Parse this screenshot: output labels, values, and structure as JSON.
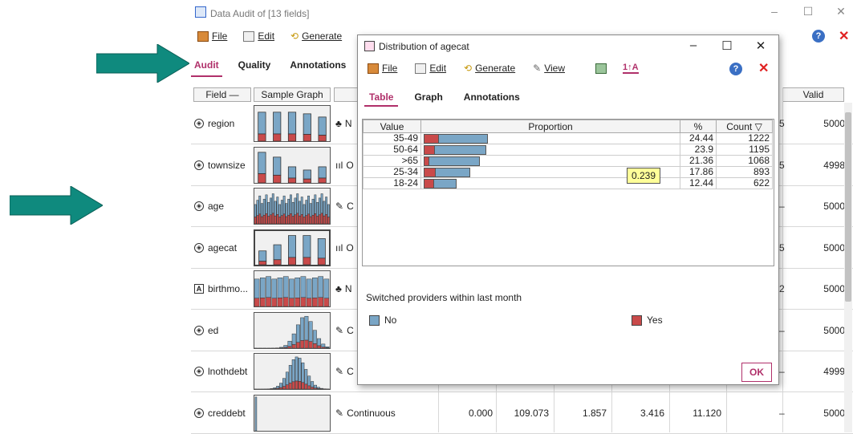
{
  "background_window": {
    "title": "Data Audit of [13 fields]",
    "menu": {
      "file": "File",
      "edit": "Edit",
      "generate": "Generate"
    },
    "tabs": [
      {
        "label": "Audit",
        "active": true
      },
      {
        "label": "Quality",
        "active": false
      },
      {
        "label": "Annotations",
        "active": false
      }
    ],
    "columns": {
      "field": "Field",
      "sample_graph": "Sample Graph",
      "valid": "Valid"
    },
    "rows": [
      {
        "field": "region",
        "icon": "nominal-icon",
        "measure_glyph": "♣",
        "measure": "N",
        "peek": "5",
        "valid": "5000"
      },
      {
        "field": "townsize",
        "icon": "ordinal-icon",
        "measure_glyph": "ııl",
        "measure": "O",
        "peek": "5",
        "valid": "4998"
      },
      {
        "field": "age",
        "icon": "continuous-icon",
        "measure_glyph": "✎",
        "measure": "C",
        "peek": "–",
        "valid": "5000"
      },
      {
        "field": "agecat",
        "icon": "ordinal-icon",
        "measure_glyph": "ııl",
        "measure": "O",
        "peek": "5",
        "valid": "5000"
      },
      {
        "field": "birthmo...",
        "icon": "text-icon",
        "measure_glyph": "♣",
        "measure": "N",
        "peek": "2",
        "valid": "5000"
      },
      {
        "field": "ed",
        "icon": "continuous-icon",
        "measure_glyph": "✎",
        "measure": "C",
        "peek": "–",
        "valid": "5000"
      },
      {
        "field": "lnothdebt",
        "icon": "continuous-icon",
        "measure_glyph": "✎",
        "measure": "C",
        "peek": "–",
        "valid": "4999"
      },
      {
        "field": "creddebt",
        "icon": "continuous-icon",
        "measure_glyph": "✎",
        "measure": "Continuous",
        "peek": "–",
        "valid": "5000",
        "stats": [
          "0.000",
          "109.073",
          "1.857",
          "3.416",
          "11.120"
        ]
      }
    ],
    "colors": {
      "accent": "#b0306a",
      "no_series": "#7aa6c6",
      "yes_series": "#c94a4a",
      "arrow": "#0f8a7e"
    }
  },
  "dialog": {
    "title": "Distribution of agecat",
    "menu": {
      "file": "File",
      "edit": "Edit",
      "generate": "Generate",
      "view": "View"
    },
    "tabs": [
      {
        "label": "Table",
        "active": true
      },
      {
        "label": "Graph",
        "active": false
      },
      {
        "label": "Annotations",
        "active": false
      }
    ],
    "table_headers": {
      "value": "Value",
      "proportion": "Proportion",
      "percent": "%",
      "count": "Count"
    },
    "rows": [
      {
        "value": "35-49",
        "percent": "24.44",
        "count": "1222",
        "pct": 24.44,
        "yes_share": 0.22
      },
      {
        "value": "50-64",
        "percent": "23.9",
        "count": "1195",
        "pct": 23.9,
        "yes_share": 0.16
      },
      {
        "value": ">65",
        "percent": "21.36",
        "count": "1068",
        "pct": 21.36,
        "yes_share": 0.08
      },
      {
        "value": "25-34",
        "percent": "17.86",
        "count": "893",
        "pct": 17.86,
        "yes_share": 0.239
      },
      {
        "value": "18-24",
        "percent": "12.44",
        "count": "622",
        "pct": 12.44,
        "yes_share": 0.3
      }
    ],
    "tooltip": "0.239",
    "legend_title": "Switched providers within last month",
    "legend": [
      {
        "label": "No",
        "color": "#7aa6c6"
      },
      {
        "label": "Yes",
        "color": "#c94a4a"
      }
    ],
    "ok_label": "OK"
  }
}
